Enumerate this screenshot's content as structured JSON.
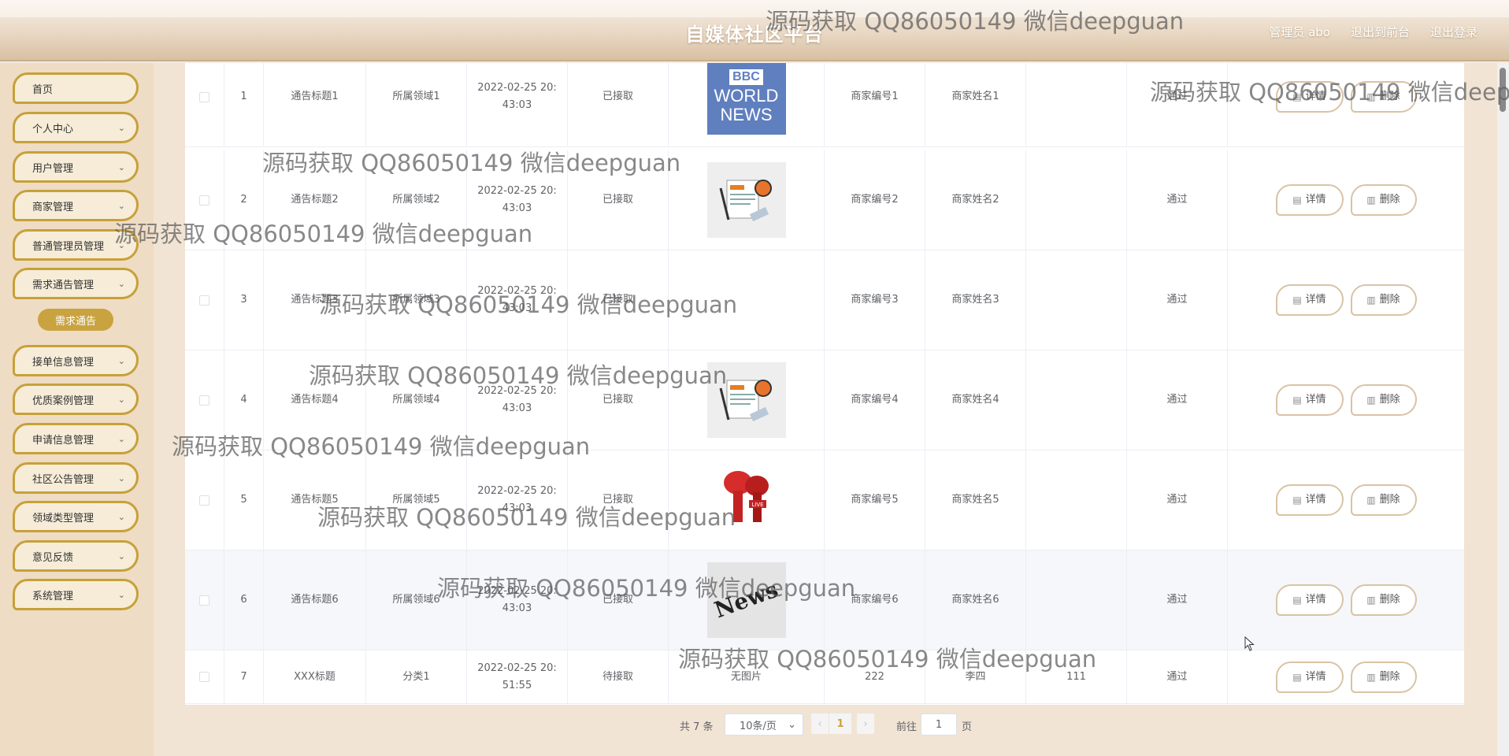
{
  "header": {
    "title": "自媒体社区平台",
    "links": [
      "管理员 abo",
      "退出到前台",
      "退出登录"
    ]
  },
  "sidebar": {
    "items": [
      {
        "label": "首页",
        "has_chevron": false
      },
      {
        "label": "个人中心",
        "has_chevron": true
      },
      {
        "label": "用户管理",
        "has_chevron": true
      },
      {
        "label": "商家管理",
        "has_chevron": true
      },
      {
        "label": "普通管理员管理",
        "has_chevron": true
      },
      {
        "label": "需求通告管理",
        "has_chevron": true
      },
      {
        "label": "接单信息管理",
        "has_chevron": true
      },
      {
        "label": "优质案例管理",
        "has_chevron": true
      },
      {
        "label": "申请信息管理",
        "has_chevron": true
      },
      {
        "label": "社区公告管理",
        "has_chevron": true
      },
      {
        "label": "领域类型管理",
        "has_chevron": true
      },
      {
        "label": "意见反馈",
        "has_chevron": true
      },
      {
        "label": "系统管理",
        "has_chevron": true
      }
    ],
    "active_submenu": "需求通告"
  },
  "table": {
    "rows": [
      {
        "index": "1",
        "title": "通告标题1",
        "field": "所属领域1",
        "date": "2022-02-25 20:",
        "time": "43:03",
        "status": "已接取",
        "image": "bbc",
        "merchant_no": "商家编号1",
        "merchant_name": "商家姓名1",
        "extra": "",
        "audit": "通过"
      },
      {
        "index": "2",
        "title": "通告标题2",
        "field": "所属领域2",
        "date": "2022-02-25 20:",
        "time": "43:03",
        "status": "已接取",
        "image": "news",
        "merchant_no": "商家编号2",
        "merchant_name": "商家姓名2",
        "extra": "",
        "audit": "通过"
      },
      {
        "index": "3",
        "title": "通告标题3",
        "field": "所属领域3",
        "date": "2022-02-25 20:",
        "time": "43:03",
        "status": "已接取",
        "image": "none",
        "merchant_no": "商家编号3",
        "merchant_name": "商家姓名3",
        "extra": "",
        "audit": "通过"
      },
      {
        "index": "4",
        "title": "通告标题4",
        "field": "所属领域4",
        "date": "2022-02-25 20:",
        "time": "43:03",
        "status": "已接取",
        "image": "news",
        "merchant_no": "商家编号4",
        "merchant_name": "商家姓名4",
        "extra": "",
        "audit": "通过"
      },
      {
        "index": "5",
        "title": "通告标题5",
        "field": "所属领域5",
        "date": "2022-02-25 20:",
        "time": "43:03",
        "status": "已接取",
        "image": "mic",
        "merchant_no": "商家编号5",
        "merchant_name": "商家姓名5",
        "extra": "",
        "audit": "通过"
      },
      {
        "index": "6",
        "title": "通告标题6",
        "field": "所属领域6",
        "date": "2022-02-25 20:",
        "time": "43:03",
        "status": "已接取",
        "image": "newspaper",
        "merchant_no": "商家编号6",
        "merchant_name": "商家姓名6",
        "extra": "",
        "audit": "通过"
      },
      {
        "index": "7",
        "title": "XXX标题",
        "field": "分类1",
        "date": "2022-02-25 20:",
        "time": "51:55",
        "status": "待接取",
        "image": "text",
        "image_text": "无图片",
        "merchant_no": "222",
        "merchant_name": "李四",
        "extra": "111",
        "audit": "通过"
      }
    ],
    "detail_label": "详情",
    "delete_label": "删除"
  },
  "thumbs": {
    "bbc_logo": "BBC",
    "bbc_line1": "WORLD",
    "bbc_line2": "NEWS",
    "newspaper_text": "News",
    "mic_live": "LIVE"
  },
  "pagination": {
    "total": "共 7 条",
    "page_size": "10条/页",
    "current_page": "1",
    "goto_label": "前往",
    "goto_value": "1",
    "page_suffix": "页"
  },
  "watermark": "源码获取 QQ86050149 微信deepguan",
  "colors": {
    "accent_gold": "#c9a340",
    "menu_border": "#c6a13a",
    "sidebar_bg": "#efdcc4"
  }
}
